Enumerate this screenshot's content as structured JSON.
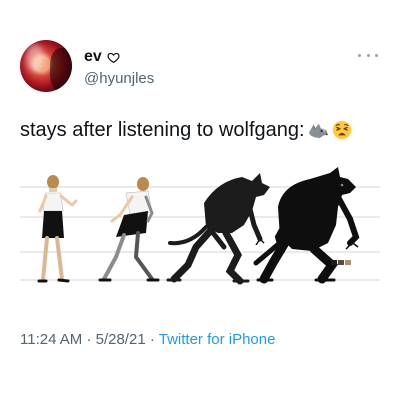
{
  "user": {
    "display_name": "ev",
    "handle": "@hyunjles",
    "name_badge_icon": "heart-outline-icon"
  },
  "tweet": {
    "text": "stays after listening to wolfgang:",
    "emojis": [
      "wolf-emoji",
      "weary-face-emoji"
    ],
    "time": "11:24 AM",
    "separator": "·",
    "date": "5/28/21",
    "source": "Twitter for iPhone"
  },
  "media": {
    "description_icon": "werewolf-transformation-illustration",
    "swatch_colors": [
      "#1a1a1a",
      "#5a4a3a",
      "#a89070"
    ]
  },
  "colors": {
    "text": "#0f1419",
    "secondary": "#536471",
    "link": "#1d9bf0"
  }
}
